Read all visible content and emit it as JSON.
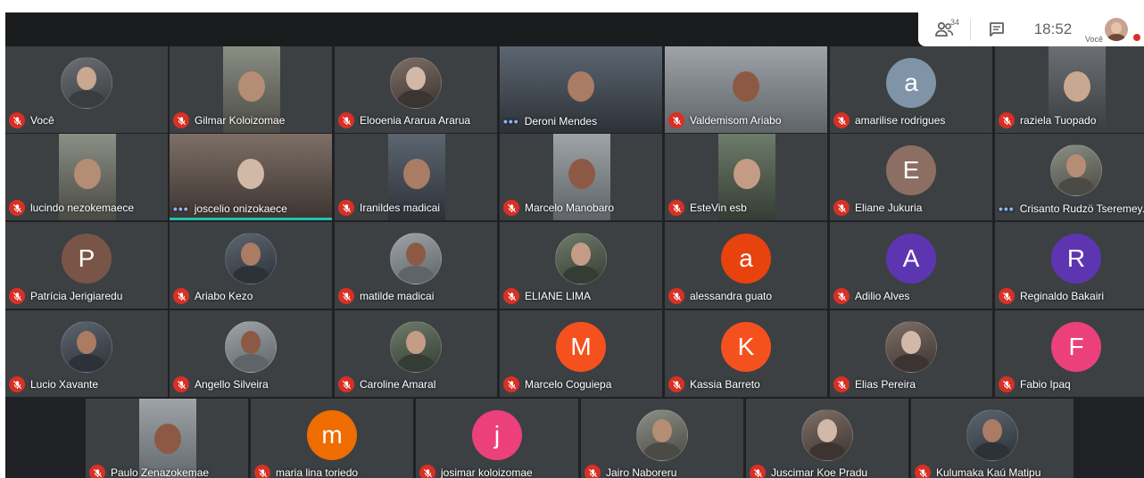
{
  "toolbar": {
    "participant_count": "34",
    "clock": "18:52",
    "self_label": "Você",
    "icons": [
      "people-icon",
      "chat-icon"
    ]
  },
  "colors": {
    "mute": "#d93025",
    "speaking": "#1ec5b0",
    "background": "#202124",
    "tile": "#3c4043"
  },
  "participants": [
    {
      "name": "Você",
      "state": "muted",
      "avatar": "photo"
    },
    {
      "name": "Gilmar Koloizomae",
      "state": "muted",
      "avatar": "video"
    },
    {
      "name": "Elooenia Ararua Ararua",
      "state": "muted",
      "avatar": "photo"
    },
    {
      "name": "Deroni Mendes",
      "state": "speaking",
      "avatar": "video"
    },
    {
      "name": "Valdemisom Ariabo",
      "state": "muted",
      "avatar": "video"
    },
    {
      "name": "amarilise rodrigues",
      "state": "muted",
      "avatar": "letter",
      "letter": "a",
      "color": "#7f94a6"
    },
    {
      "name": "raziela Tuopado",
      "state": "muted",
      "avatar": "video"
    },
    {
      "name": "lucindo nezokemaece",
      "state": "muted",
      "avatar": "video"
    },
    {
      "name": "joscelio onizokaece",
      "state": "speaking",
      "avatar": "video"
    },
    {
      "name": "Iranildes madicai",
      "state": "muted",
      "avatar": "video"
    },
    {
      "name": "Marcelo Manobaro",
      "state": "muted",
      "avatar": "video"
    },
    {
      "name": "EsteVin esb",
      "state": "muted",
      "avatar": "video"
    },
    {
      "name": "Eliane Jukuria",
      "state": "muted",
      "avatar": "letter",
      "letter": "E",
      "color": "#8d6e63"
    },
    {
      "name": "Crisanto Rudzö Tseremey.",
      "state": "speaking",
      "avatar": "photo"
    },
    {
      "name": "Patrícia Jerigiaredu",
      "state": "muted",
      "avatar": "letter",
      "letter": "P",
      "color": "#795548"
    },
    {
      "name": "Ariabo Kezo",
      "state": "muted",
      "avatar": "photo"
    },
    {
      "name": "matilde madicai",
      "state": "muted",
      "avatar": "photo"
    },
    {
      "name": "ELIANE LIMA",
      "state": "muted",
      "avatar": "photo"
    },
    {
      "name": "alessandra guato",
      "state": "muted",
      "avatar": "letter",
      "letter": "a",
      "color": "#e8430e"
    },
    {
      "name": "Adilio Alves",
      "state": "muted",
      "avatar": "letter",
      "letter": "A",
      "color": "#5e35b1"
    },
    {
      "name": "Reginaldo Bakairi",
      "state": "muted",
      "avatar": "letter",
      "letter": "R",
      "color": "#5e35b1"
    },
    {
      "name": "Lucio Xavante",
      "state": "muted",
      "avatar": "photo"
    },
    {
      "name": "Angello Silveira",
      "state": "muted",
      "avatar": "photo"
    },
    {
      "name": "Caroline Amaral",
      "state": "muted",
      "avatar": "photo"
    },
    {
      "name": "Marcelo Coguiepa",
      "state": "muted",
      "avatar": "letter",
      "letter": "M",
      "color": "#f4511e"
    },
    {
      "name": "Kassia Barreto",
      "state": "muted",
      "avatar": "letter",
      "letter": "K",
      "color": "#f4511e"
    },
    {
      "name": "Elias Pereira",
      "state": "muted",
      "avatar": "photo"
    },
    {
      "name": "Fabio Ipaq",
      "state": "muted",
      "avatar": "letter",
      "letter": "F",
      "color": "#ec407a"
    },
    {
      "name": "Paulo Zenazokemae",
      "state": "muted",
      "avatar": "video"
    },
    {
      "name": "maria lina toriedo",
      "state": "muted",
      "avatar": "letter",
      "letter": "m",
      "color": "#ef6c00"
    },
    {
      "name": "josimar koloizomae",
      "state": "muted",
      "avatar": "letter",
      "letter": "j",
      "color": "#ec407a"
    },
    {
      "name": "Jairo Naboreru",
      "state": "muted",
      "avatar": "photo"
    },
    {
      "name": "Juscimar Koe Pradu",
      "state": "muted",
      "avatar": "photo"
    },
    {
      "name": "Kulumaka Kaú Matipu",
      "state": "muted",
      "avatar": "photo"
    }
  ]
}
